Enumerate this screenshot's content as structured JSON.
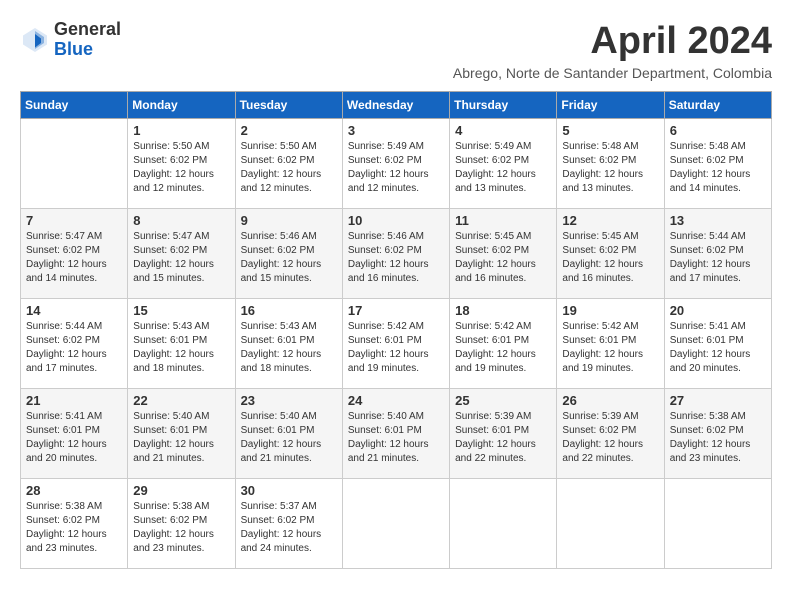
{
  "header": {
    "logo_general": "General",
    "logo_blue": "Blue",
    "month_title": "April 2024",
    "location": "Abrego, Norte de Santander Department, Colombia"
  },
  "weekdays": [
    "Sunday",
    "Monday",
    "Tuesday",
    "Wednesday",
    "Thursday",
    "Friday",
    "Saturday"
  ],
  "weeks": [
    [
      {
        "day": null
      },
      {
        "day": "1",
        "sunrise": "5:50 AM",
        "sunset": "6:02 PM",
        "daylight": "12 hours and 12 minutes."
      },
      {
        "day": "2",
        "sunrise": "5:50 AM",
        "sunset": "6:02 PM",
        "daylight": "12 hours and 12 minutes."
      },
      {
        "day": "3",
        "sunrise": "5:49 AM",
        "sunset": "6:02 PM",
        "daylight": "12 hours and 12 minutes."
      },
      {
        "day": "4",
        "sunrise": "5:49 AM",
        "sunset": "6:02 PM",
        "daylight": "12 hours and 13 minutes."
      },
      {
        "day": "5",
        "sunrise": "5:48 AM",
        "sunset": "6:02 PM",
        "daylight": "12 hours and 13 minutes."
      },
      {
        "day": "6",
        "sunrise": "5:48 AM",
        "sunset": "6:02 PM",
        "daylight": "12 hours and 14 minutes."
      }
    ],
    [
      {
        "day": "7",
        "sunrise": "5:47 AM",
        "sunset": "6:02 PM",
        "daylight": "12 hours and 14 minutes."
      },
      {
        "day": "8",
        "sunrise": "5:47 AM",
        "sunset": "6:02 PM",
        "daylight": "12 hours and 15 minutes."
      },
      {
        "day": "9",
        "sunrise": "5:46 AM",
        "sunset": "6:02 PM",
        "daylight": "12 hours and 15 minutes."
      },
      {
        "day": "10",
        "sunrise": "5:46 AM",
        "sunset": "6:02 PM",
        "daylight": "12 hours and 16 minutes."
      },
      {
        "day": "11",
        "sunrise": "5:45 AM",
        "sunset": "6:02 PM",
        "daylight": "12 hours and 16 minutes."
      },
      {
        "day": "12",
        "sunrise": "5:45 AM",
        "sunset": "6:02 PM",
        "daylight": "12 hours and 16 minutes."
      },
      {
        "day": "13",
        "sunrise": "5:44 AM",
        "sunset": "6:02 PM",
        "daylight": "12 hours and 17 minutes."
      }
    ],
    [
      {
        "day": "14",
        "sunrise": "5:44 AM",
        "sunset": "6:02 PM",
        "daylight": "12 hours and 17 minutes."
      },
      {
        "day": "15",
        "sunrise": "5:43 AM",
        "sunset": "6:01 PM",
        "daylight": "12 hours and 18 minutes."
      },
      {
        "day": "16",
        "sunrise": "5:43 AM",
        "sunset": "6:01 PM",
        "daylight": "12 hours and 18 minutes."
      },
      {
        "day": "17",
        "sunrise": "5:42 AM",
        "sunset": "6:01 PM",
        "daylight": "12 hours and 19 minutes."
      },
      {
        "day": "18",
        "sunrise": "5:42 AM",
        "sunset": "6:01 PM",
        "daylight": "12 hours and 19 minutes."
      },
      {
        "day": "19",
        "sunrise": "5:42 AM",
        "sunset": "6:01 PM",
        "daylight": "12 hours and 19 minutes."
      },
      {
        "day": "20",
        "sunrise": "5:41 AM",
        "sunset": "6:01 PM",
        "daylight": "12 hours and 20 minutes."
      }
    ],
    [
      {
        "day": "21",
        "sunrise": "5:41 AM",
        "sunset": "6:01 PM",
        "daylight": "12 hours and 20 minutes."
      },
      {
        "day": "22",
        "sunrise": "5:40 AM",
        "sunset": "6:01 PM",
        "daylight": "12 hours and 21 minutes."
      },
      {
        "day": "23",
        "sunrise": "5:40 AM",
        "sunset": "6:01 PM",
        "daylight": "12 hours and 21 minutes."
      },
      {
        "day": "24",
        "sunrise": "5:40 AM",
        "sunset": "6:01 PM",
        "daylight": "12 hours and 21 minutes."
      },
      {
        "day": "25",
        "sunrise": "5:39 AM",
        "sunset": "6:01 PM",
        "daylight": "12 hours and 22 minutes."
      },
      {
        "day": "26",
        "sunrise": "5:39 AM",
        "sunset": "6:02 PM",
        "daylight": "12 hours and 22 minutes."
      },
      {
        "day": "27",
        "sunrise": "5:38 AM",
        "sunset": "6:02 PM",
        "daylight": "12 hours and 23 minutes."
      }
    ],
    [
      {
        "day": "28",
        "sunrise": "5:38 AM",
        "sunset": "6:02 PM",
        "daylight": "12 hours and 23 minutes."
      },
      {
        "day": "29",
        "sunrise": "5:38 AM",
        "sunset": "6:02 PM",
        "daylight": "12 hours and 23 minutes."
      },
      {
        "day": "30",
        "sunrise": "5:37 AM",
        "sunset": "6:02 PM",
        "daylight": "12 hours and 24 minutes."
      },
      {
        "day": null
      },
      {
        "day": null
      },
      {
        "day": null
      },
      {
        "day": null
      }
    ]
  ]
}
